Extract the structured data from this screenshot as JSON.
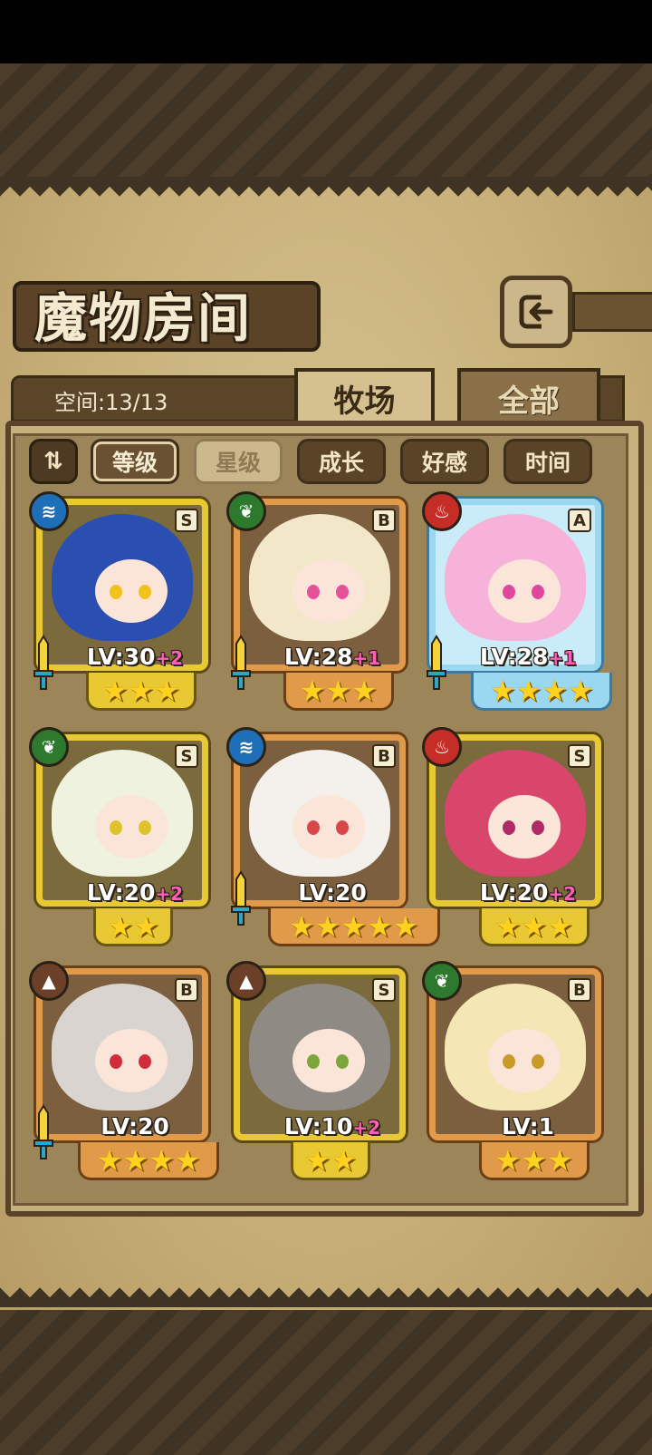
{
  "title": "魔物房间",
  "capacity": "空间:13/13",
  "tabs": {
    "ranch": "牧场",
    "all": "全部"
  },
  "sort": {
    "order_icon": "sort-order-icon",
    "level": "等级",
    "star": "星级",
    "growth": "成长",
    "affection": "好感",
    "time": "时间"
  },
  "icons": {
    "back": "back-icon",
    "equipment": "sword-icon"
  },
  "colors": {
    "gold_frame": "#e8c933",
    "bronze_frame": "#e19a4a",
    "crystal_frame": "#9ad7f0",
    "plus_level": "#ff5fb8"
  },
  "monsters": [
    {
      "rank": "S",
      "element": "water",
      "element_glyph": "≋",
      "level": "LV:30",
      "plus": "+2",
      "stars": "★★★",
      "stars_count": 3,
      "equipped": true,
      "frame": "gold"
    },
    {
      "rank": "B",
      "element": "grass",
      "element_glyph": "❦",
      "level": "LV:28",
      "plus": "+1",
      "stars": "★★★",
      "stars_count": 3,
      "equipped": true,
      "frame": "bronze"
    },
    {
      "rank": "A",
      "element": "fire",
      "element_glyph": "♨",
      "level": "LV:28",
      "plus": "+1",
      "stars": "★★★★",
      "stars_count": 4,
      "equipped": true,
      "frame": "crystal"
    },
    {
      "rank": "S",
      "element": "grass",
      "element_glyph": "❦",
      "level": "LV:20",
      "plus": "+2",
      "stars": "★★",
      "stars_count": 2,
      "equipped": false,
      "frame": "gold"
    },
    {
      "rank": "B",
      "element": "water",
      "element_glyph": "≋",
      "level": "LV:20",
      "plus": "",
      "stars": "★★★★★",
      "stars_count": 5,
      "equipped": true,
      "frame": "bronze"
    },
    {
      "rank": "S",
      "element": "fire",
      "element_glyph": "♨",
      "level": "LV:20",
      "plus": "+2",
      "stars": "★★★",
      "stars_count": 3,
      "equipped": false,
      "frame": "gold"
    },
    {
      "rank": "B",
      "element": "earth",
      "element_glyph": "▲",
      "level": "LV:20",
      "plus": "",
      "stars": "★★★★",
      "stars_count": 4,
      "equipped": true,
      "frame": "bronze"
    },
    {
      "rank": "S",
      "element": "earth",
      "element_glyph": "▲",
      "level": "LV:10",
      "plus": "+2",
      "stars": "★★",
      "stars_count": 2,
      "equipped": false,
      "frame": "gold"
    },
    {
      "rank": "B",
      "element": "grass",
      "element_glyph": "❦",
      "level": "LV:1",
      "plus": "",
      "stars": "★★★",
      "stars_count": 3,
      "equipped": false,
      "frame": "bronze"
    }
  ]
}
